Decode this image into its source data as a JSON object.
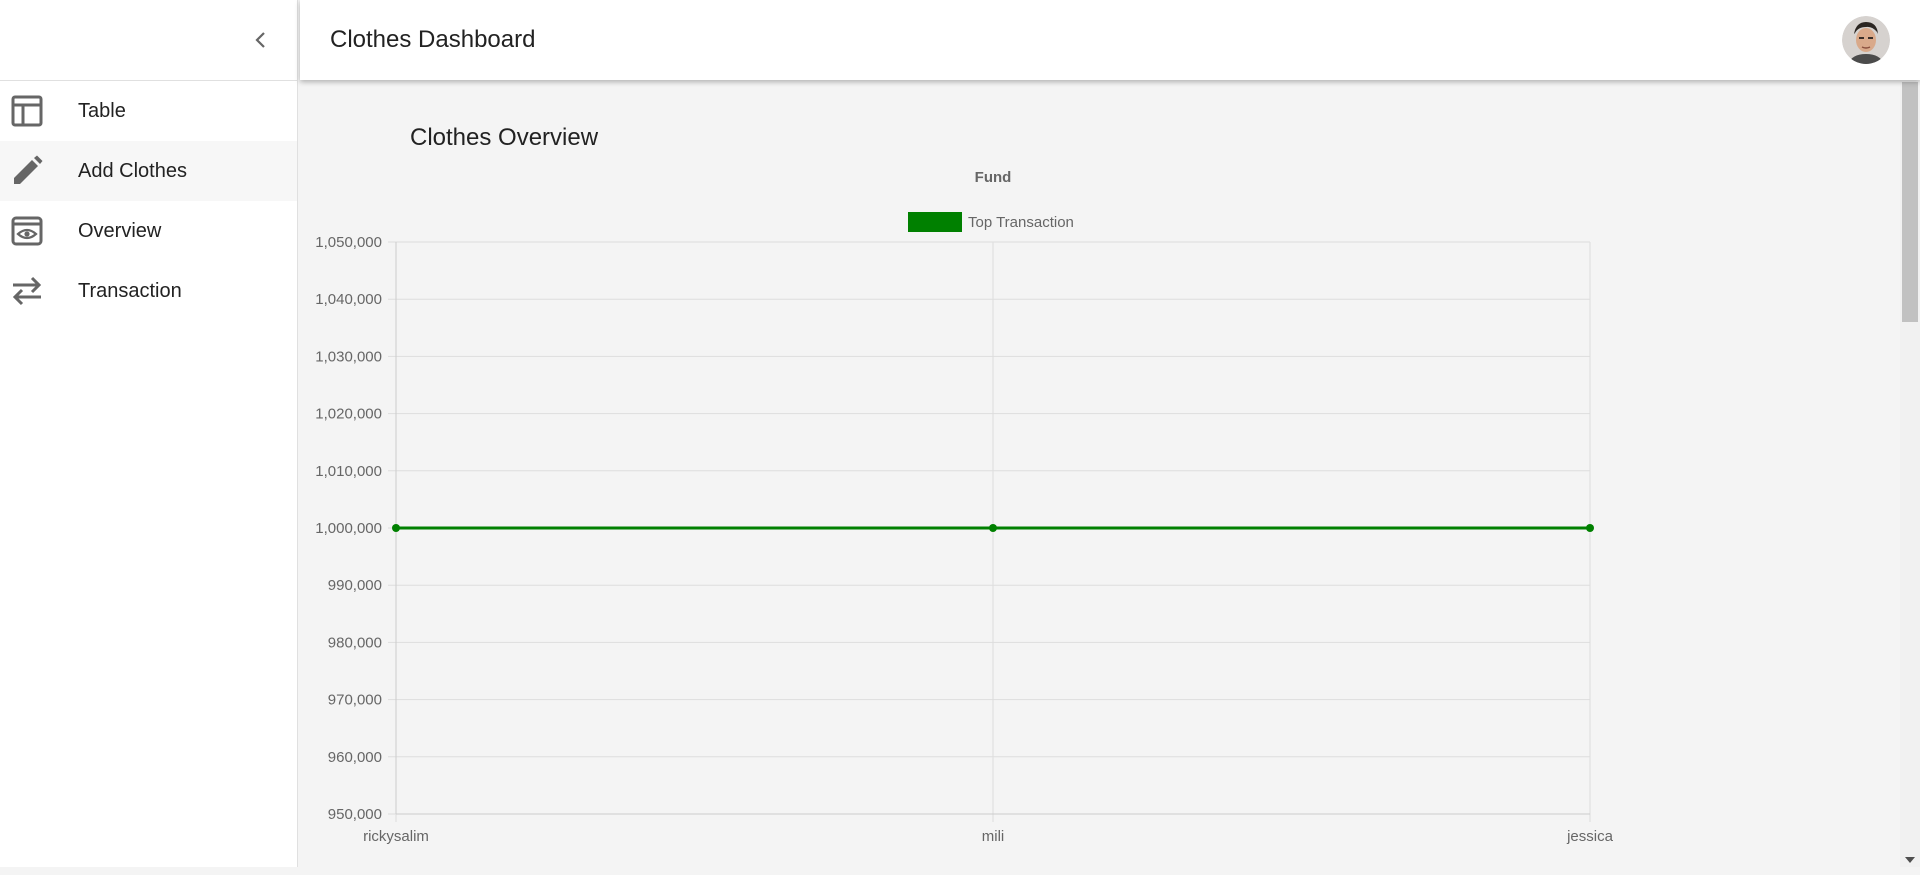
{
  "header": {
    "title": "Clothes Dashboard",
    "avatar_icon": "user-avatar"
  },
  "sidebar": {
    "collapse_icon": "chevron-left-icon",
    "items": [
      {
        "label": "Table",
        "icon": "table-icon"
      },
      {
        "label": "Add Clothes",
        "icon": "pencil-icon"
      },
      {
        "label": "Overview",
        "icon": "eye-icon"
      },
      {
        "label": "Transaction",
        "icon": "swap-arrows-icon"
      }
    ]
  },
  "main": {
    "section_title": "Clothes Overview"
  },
  "chart_data": {
    "type": "line",
    "title": "Fund",
    "categories": [
      "rickysalim",
      "mili",
      "jessica"
    ],
    "series": [
      {
        "name": "Top Transaction",
        "values": [
          1000000,
          1000000,
          1000000
        ],
        "color": "#008000"
      }
    ],
    "ylim": [
      950000,
      1050000
    ],
    "yticks": [
      "1,050,000",
      "1,040,000",
      "1,030,000",
      "1,020,000",
      "1,010,000",
      "1,000,000",
      "990,000",
      "980,000",
      "970,000",
      "960,000",
      "950,000"
    ],
    "grid": true,
    "legend": "top-center"
  }
}
